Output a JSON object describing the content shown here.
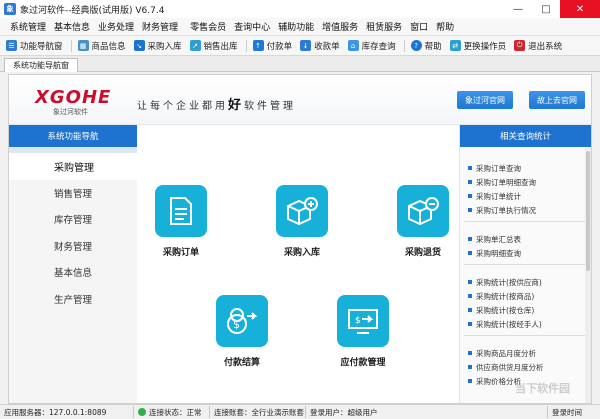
{
  "window": {
    "title": "象过河软件--经典版(试用版) V6.7.4",
    "minimize": "—",
    "maximize": "□",
    "close": "✕"
  },
  "menu": [
    "系统管理",
    "基本信息",
    "业务处理",
    "财务管理",
    "零售会员",
    "查询中心",
    "辅助功能",
    "增值服务",
    "租赁服务",
    "窗口",
    "帮助"
  ],
  "toolbar": [
    {
      "label": "功能导航窗",
      "icon": "nav-icon",
      "color": "#2e7bd6"
    },
    {
      "label": "商品信息",
      "icon": "goods-icon",
      "color": "#4a90c8"
    },
    {
      "label": "采购入库",
      "icon": "purchase-in-icon",
      "color": "#1e73d0"
    },
    {
      "label": "销售出库",
      "icon": "sales-out-icon",
      "color": "#2aa0d6"
    },
    {
      "label": "付款单",
      "icon": "payment-icon",
      "color": "#1f78d1"
    },
    {
      "label": "收款单",
      "icon": "receipt-icon",
      "color": "#2e7bd6"
    },
    {
      "label": "库存查询",
      "icon": "stock-query-icon",
      "color": "#3d95e8"
    },
    {
      "label": "帮助",
      "icon": "help-icon",
      "color": "#1e73d0"
    },
    {
      "label": "更换操作员",
      "icon": "switch-user-icon",
      "color": "#2aa0d6"
    },
    {
      "label": "退出系统",
      "icon": "exit-icon",
      "color": "#d0262e"
    }
  ],
  "tab": "系统功能导航窗",
  "banner": {
    "logo": "XGOHE",
    "logo_sub": "象过河软件",
    "slogan_pre": "让每个企业都用",
    "slogan_em": "好",
    "slogan_post": "软件管理",
    "btn_official": "象过河官网",
    "btn_upgrade": "故上去官网"
  },
  "leftnav": {
    "title": "系统功能导航",
    "items": [
      "采购管理",
      "销售管理",
      "库存管理",
      "财务管理",
      "基本信息",
      "生产管理"
    ]
  },
  "tiles": [
    {
      "label": "采购订单",
      "icon": "document-icon"
    },
    {
      "label": "采购入库",
      "icon": "box-plus-icon"
    },
    {
      "label": "采购退货",
      "icon": "box-minus-icon"
    },
    {
      "label": "付款结算",
      "icon": "coins-icon"
    },
    {
      "label": "应付款管理",
      "icon": "monitor-icon"
    }
  ],
  "rightpanel": {
    "title": "相关查询统计",
    "groups": [
      [
        "采购订单查询",
        "采购订单明细查询",
        "采购订单统计",
        "采购订单执行情况"
      ],
      [
        "采购单汇总表",
        "采购明细查询"
      ],
      [
        "采购统计(按供应商)",
        "采购统计(按商品)",
        "采购统计(按仓库)",
        "采购统计(按经手人)"
      ],
      [
        "采购商品月度分析",
        "供应商供货月度分析",
        "采购价格分析"
      ]
    ]
  },
  "status": {
    "server": "应用服务器：127.0.0.1:8089",
    "connect": "连接状态：正常",
    "account": "连接账套：全行业演示账套",
    "user": "登录用户：超级用户",
    "login_time": "登录时间"
  },
  "watermark": "当下软件园"
}
